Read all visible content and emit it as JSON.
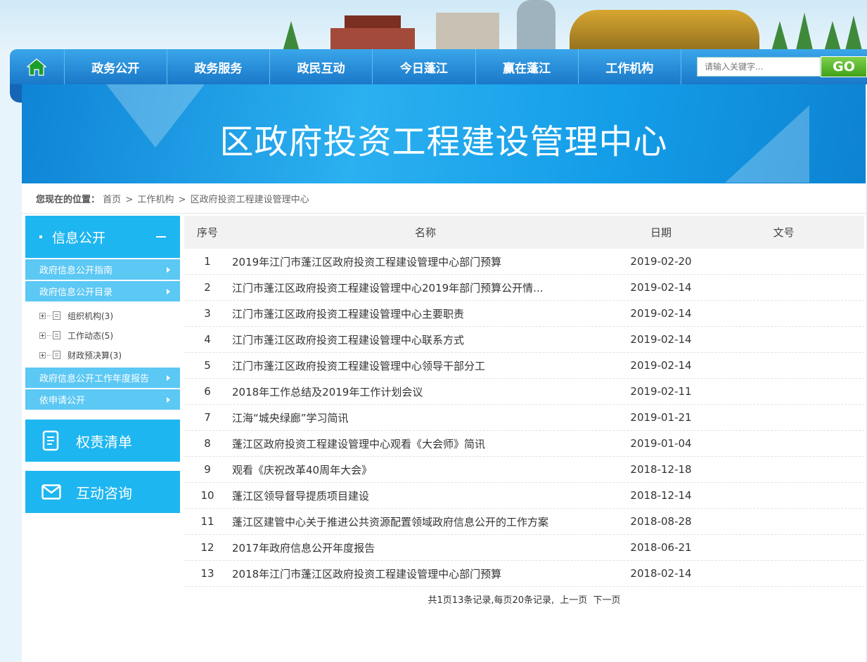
{
  "nav": {
    "items": [
      "政务公开",
      "政务服务",
      "政民互动",
      "今日蓬江",
      "赢在蓬江",
      "工作机构"
    ],
    "search_placeholder": "请输入关键字...",
    "go_label": "GO"
  },
  "banner": {
    "title": "区政府投资工程建设管理中心"
  },
  "breadcrumb": {
    "label": "您现在的位置：",
    "items": [
      "首页",
      "工作机构",
      "区政府投资工程建设管理中心"
    ],
    "sep": ">"
  },
  "sidebar": {
    "head": "信息公开",
    "subs": [
      "政府信息公开指南",
      "政府信息公开目录"
    ],
    "tree": [
      "组织机构(3)",
      "工作动态(5)",
      "财政预决算(3)"
    ],
    "subs2": [
      "政府信息公开工作年度报告",
      "依申请公开"
    ],
    "tiles": [
      "权责清单",
      "互动咨询"
    ]
  },
  "table": {
    "headers": [
      "序号",
      "名称",
      "日期",
      "文号"
    ],
    "rows": [
      {
        "no": "1",
        "name": "2019年江门市蓬江区政府投资工程建设管理中心部门预算",
        "date": "2019-02-20",
        "doc": ""
      },
      {
        "no": "2",
        "name": "江门市蓬江区政府投资工程建设管理中心2019年部门预算公开情...",
        "date": "2019-02-14",
        "doc": ""
      },
      {
        "no": "3",
        "name": "江门市蓬江区政府投资工程建设管理中心主要职责",
        "date": "2019-02-14",
        "doc": ""
      },
      {
        "no": "4",
        "name": "江门市蓬江区政府投资工程建设管理中心联系方式",
        "date": "2019-02-14",
        "doc": ""
      },
      {
        "no": "5",
        "name": "江门市蓬江区政府投资工程建设管理中心领导干部分工",
        "date": "2019-02-14",
        "doc": ""
      },
      {
        "no": "6",
        "name": "2018年工作总结及2019年工作计划会议",
        "date": "2019-02-11",
        "doc": ""
      },
      {
        "no": "7",
        "name": "江海“城央绿廊”学习简讯",
        "date": "2019-01-21",
        "doc": ""
      },
      {
        "no": "8",
        "name": "蓬江区政府投资工程建设管理中心观看《大会师》简讯",
        "date": "2019-01-04",
        "doc": ""
      },
      {
        "no": "9",
        "name": "观看《庆祝改革40周年大会》",
        "date": "2018-12-18",
        "doc": ""
      },
      {
        "no": "10",
        "name": "蓬江区领导督导提质项目建设",
        "date": "2018-12-14",
        "doc": ""
      },
      {
        "no": "11",
        "name": "蓬江区建管中心关于推进公共资源配置领域政府信息公开的工作方案",
        "date": "2018-08-28",
        "doc": ""
      },
      {
        "no": "12",
        "name": "2017年政府信息公开年度报告",
        "date": "2018-06-21",
        "doc": ""
      },
      {
        "no": "13",
        "name": "2018年江门市蓬江区政府投资工程建设管理中心部门预算",
        "date": "2018-02-14",
        "doc": ""
      }
    ]
  },
  "pager": {
    "summary": "共1页13条记录,每页20条记录,",
    "prev": "上一页",
    "next": "下一页"
  },
  "colors": {
    "nav": "#1a78c9",
    "accent": "#1eb6f0",
    "go": "#3fa21a"
  }
}
